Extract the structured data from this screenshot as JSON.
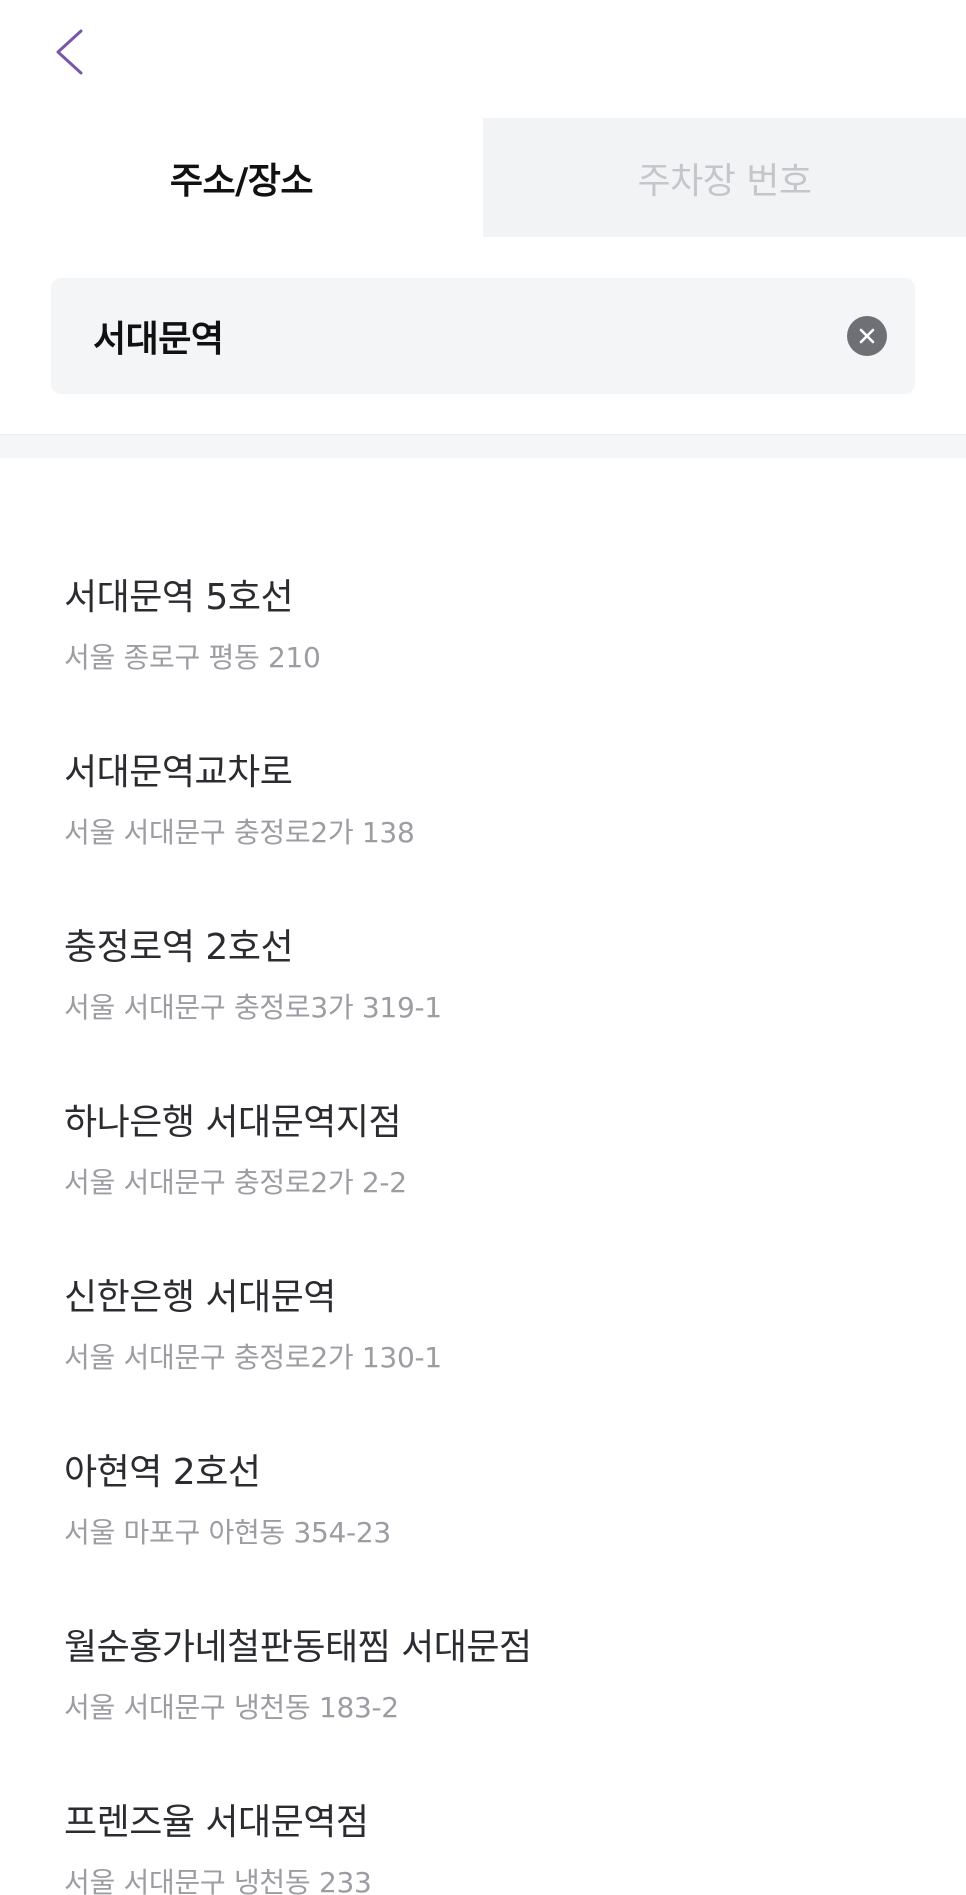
{
  "header": {
    "back_icon": "chevron-left-icon",
    "back_icon_color": "#7a57a8"
  },
  "tabs": [
    {
      "label": "주소/장소",
      "active": true
    },
    {
      "label": "주차장 번호",
      "active": false
    }
  ],
  "search": {
    "value": "서대문역",
    "clear_icon": "close-circle-icon"
  },
  "results": [
    {
      "name": "서대문역 5호선",
      "address": "서울 종로구 평동 210"
    },
    {
      "name": "서대문역교차로",
      "address": "서울 서대문구 충정로2가 138"
    },
    {
      "name": "충정로역 2호선",
      "address": "서울 서대문구 충정로3가 319-1"
    },
    {
      "name": "하나은행 서대문역지점",
      "address": "서울 서대문구 충정로2가 2-2"
    },
    {
      "name": "신한은행 서대문역",
      "address": "서울 서대문구 충정로2가 130-1"
    },
    {
      "name": "아현역 2호선",
      "address": "서울 마포구 아현동 354-23"
    },
    {
      "name": "월순홍가네철판동태찜 서대문점",
      "address": "서울 서대문구 냉천동 183-2"
    },
    {
      "name": "프렌즈율 서대문역점",
      "address": "서울 서대문구 냉천동 233"
    }
  ],
  "colors": {
    "accent": "#7a57a8",
    "inactive_tab_bg": "#f2f3f5",
    "inactive_tab_text": "#c4c6cc",
    "search_bg": "#f4f5f7",
    "address_text": "#9c9da2"
  }
}
